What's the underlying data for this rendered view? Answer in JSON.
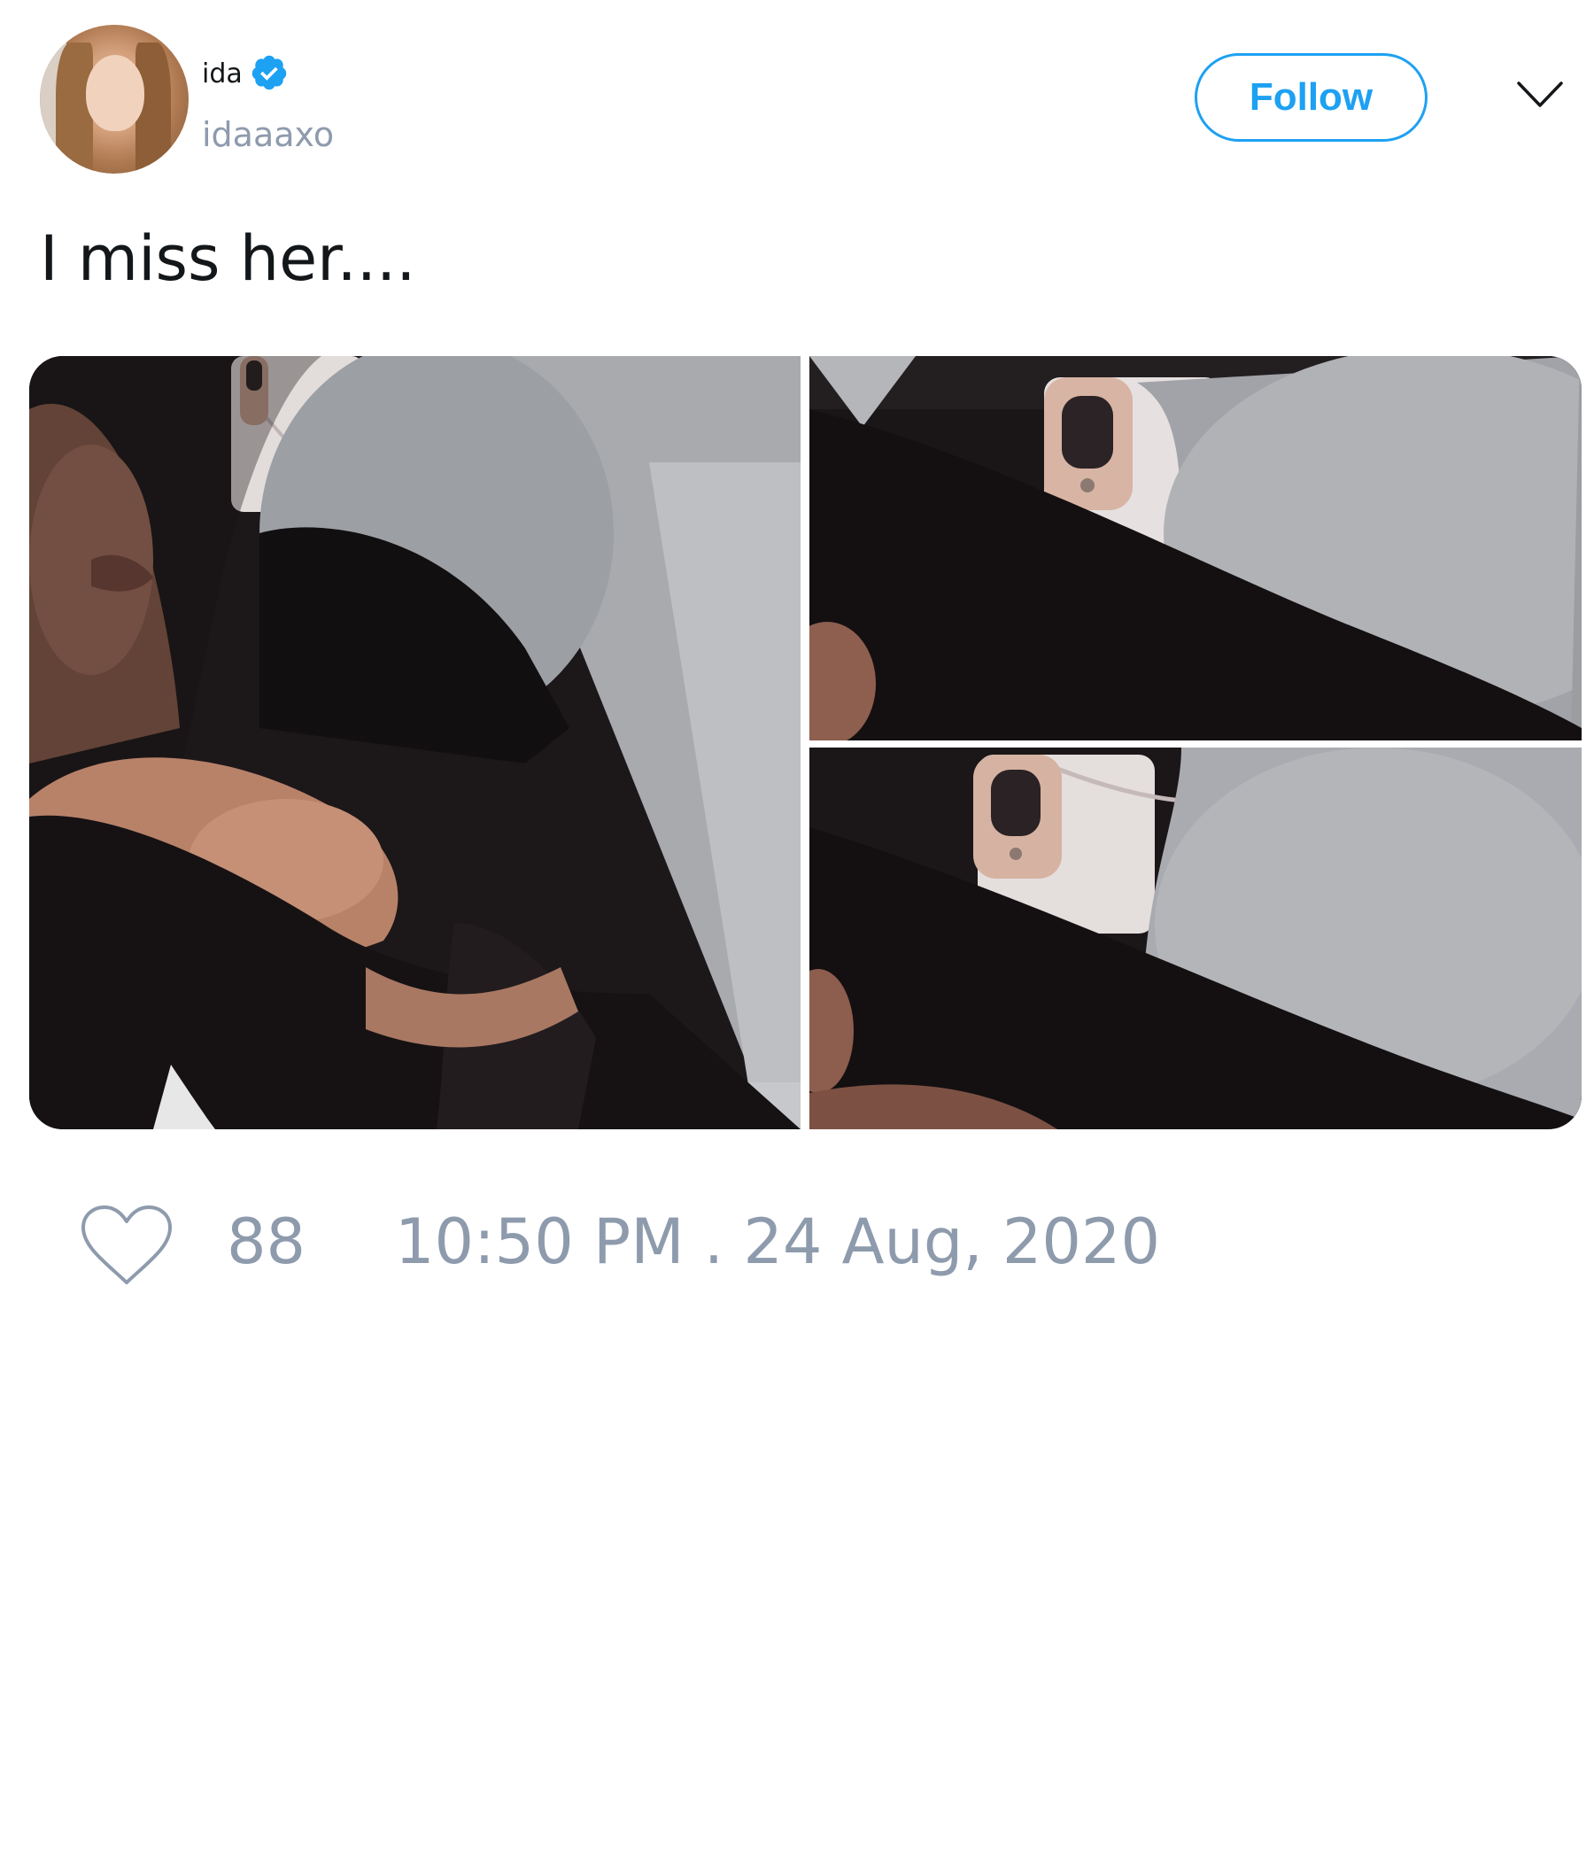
{
  "user": {
    "display_name": "ida",
    "handle": "idaaaxo",
    "verified": true,
    "avatar_icon": "profile-photo"
  },
  "header": {
    "follow_label": "Follow",
    "menu_icon": "chevron-down-icon"
  },
  "tweet": {
    "text": "I miss her....",
    "media_count": 3
  },
  "footer": {
    "like_icon": "heart-icon",
    "like_count": "88",
    "timestamp": "10:50 PM . 24 Aug, 2020"
  },
  "colors": {
    "accent": "#1da1f2",
    "muted_text": "#8e9bad",
    "primary_text": "#14171a"
  }
}
